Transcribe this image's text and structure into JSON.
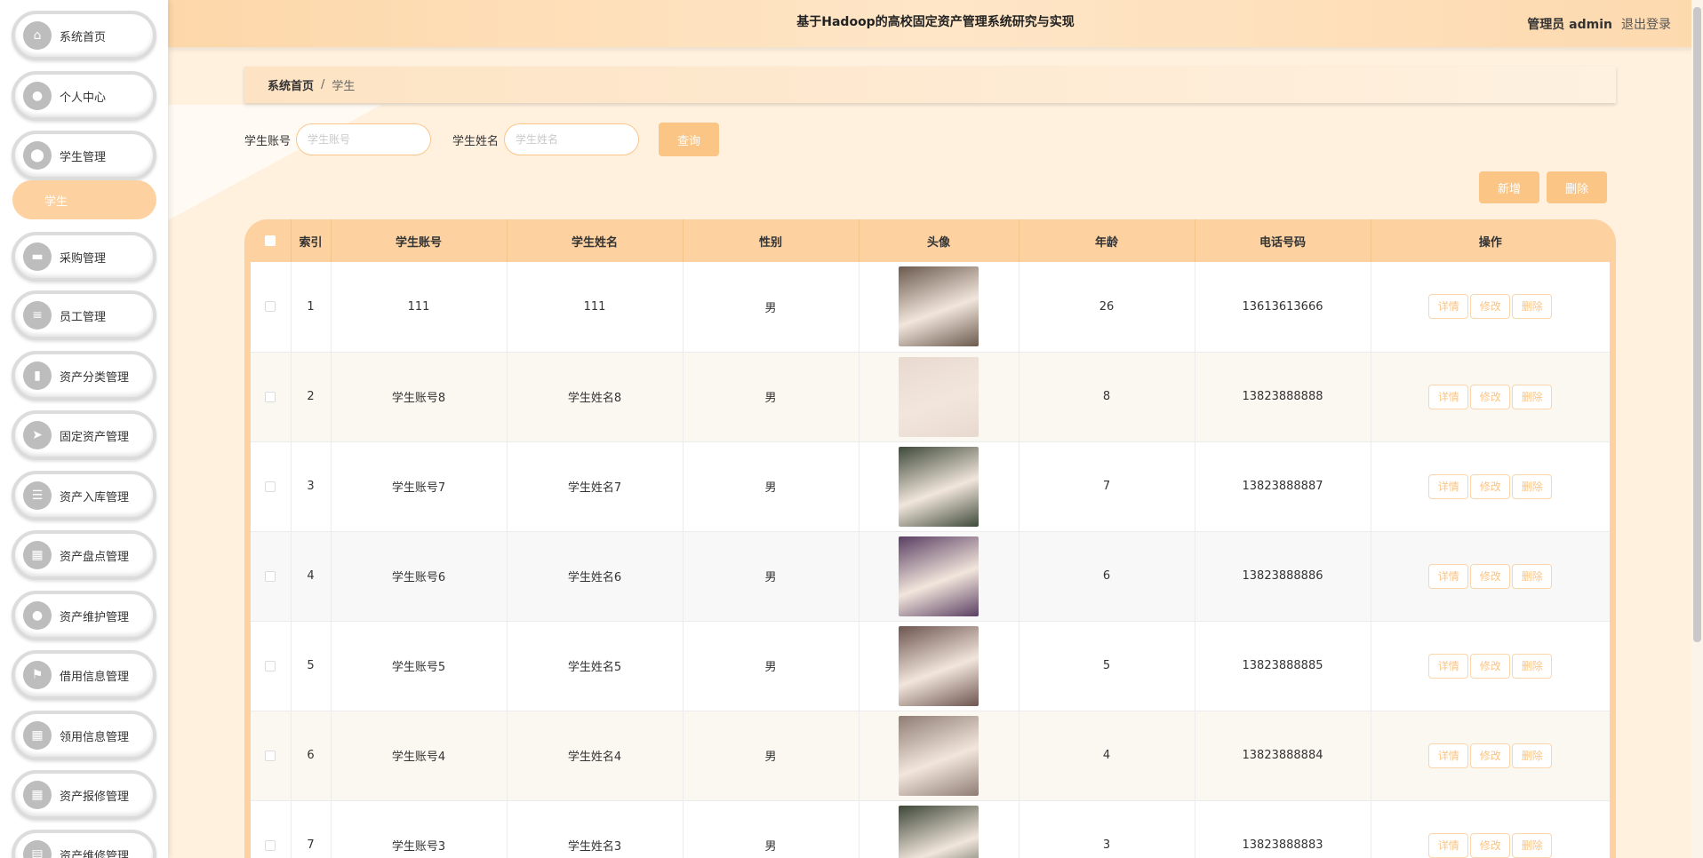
{
  "app": {
    "title": "基于Hadoop的高校固定资产管理系统研究与实现",
    "user_label": "管理员 admin",
    "logout_label": "退出登录"
  },
  "sidebar": {
    "items": [
      {
        "label": "系统首页",
        "icon": "home-icon",
        "glyph": "⌂"
      },
      {
        "label": "个人中心",
        "icon": "user-icon",
        "glyph": "●"
      },
      {
        "label": "学生管理",
        "icon": "pin-icon",
        "glyph": "⬤"
      },
      {
        "label": "采购管理",
        "icon": "briefcase-icon",
        "glyph": "▬"
      },
      {
        "label": "员工管理",
        "icon": "list-icon",
        "glyph": "≡"
      },
      {
        "label": "资产分类管理",
        "icon": "tablet-icon",
        "glyph": "▮"
      },
      {
        "label": "固定资产管理",
        "icon": "send-icon",
        "glyph": "➤"
      },
      {
        "label": "资产入库管理",
        "icon": "sliders-icon",
        "glyph": "☰"
      },
      {
        "label": "资产盘点管理",
        "icon": "grid-icon",
        "glyph": "▦"
      },
      {
        "label": "资产维护管理",
        "icon": "person-icon",
        "glyph": "●"
      },
      {
        "label": "借用信息管理",
        "icon": "flag-icon",
        "glyph": "⚑"
      },
      {
        "label": "领用信息管理",
        "icon": "apps-icon",
        "glyph": "▦"
      },
      {
        "label": "资产报修管理",
        "icon": "grid-icon",
        "glyph": "▦"
      },
      {
        "label": "资产维修管理",
        "icon": "chart-icon",
        "glyph": "▤"
      }
    ],
    "active_sub": "学生"
  },
  "breadcrumb": {
    "home": "系统首页",
    "separator": "/",
    "current": "学生"
  },
  "search": {
    "account_label": "学生账号",
    "account_placeholder": "学生账号",
    "account_value": "",
    "name_label": "学生姓名",
    "name_placeholder": "学生姓名",
    "name_value": "",
    "query_label": "查询"
  },
  "actions": {
    "add_label": "新增",
    "delete_label": "删除"
  },
  "table": {
    "columns": [
      "索引",
      "学生账号",
      "学生姓名",
      "性别",
      "头像",
      "年龄",
      "电话号码",
      "操作"
    ],
    "row_buttons": {
      "detail": "详情",
      "edit": "修改",
      "delete": "删除"
    },
    "rows": [
      {
        "index": "1",
        "account": "111",
        "name": "111",
        "gender": "男",
        "age": "26",
        "phone": "13613613666",
        "avatar_color": "#6b5a4e"
      },
      {
        "index": "2",
        "account": "学生账号8",
        "name": "学生姓名8",
        "gender": "男",
        "age": "8",
        "phone": "13823888888",
        "avatar_color": "#e8d9cf"
      },
      {
        "index": "3",
        "account": "学生账号7",
        "name": "学生姓名7",
        "gender": "男",
        "age": "7",
        "phone": "13823888887",
        "avatar_color": "#3e4a3a"
      },
      {
        "index": "4",
        "account": "学生账号6",
        "name": "学生姓名6",
        "gender": "男",
        "age": "6",
        "phone": "13823888886",
        "avatar_color": "#5a3f63"
      },
      {
        "index": "5",
        "account": "学生账号5",
        "name": "学生姓名5",
        "gender": "男",
        "age": "5",
        "phone": "13823888885",
        "avatar_color": "#6d5550"
      },
      {
        "index": "6",
        "account": "学生账号4",
        "name": "学生姓名4",
        "gender": "男",
        "age": "4",
        "phone": "13823888884",
        "avatar_color": "#8f7d74"
      },
      {
        "index": "7",
        "account": "学生账号3",
        "name": "学生姓名3",
        "gender": "男",
        "age": "3",
        "phone": "13823888883",
        "avatar_color": "#3c4637"
      }
    ]
  },
  "colors": {
    "accent": "#fbc585",
    "header_bg": "#fdd1a0",
    "page_bg": "#fff1de"
  }
}
